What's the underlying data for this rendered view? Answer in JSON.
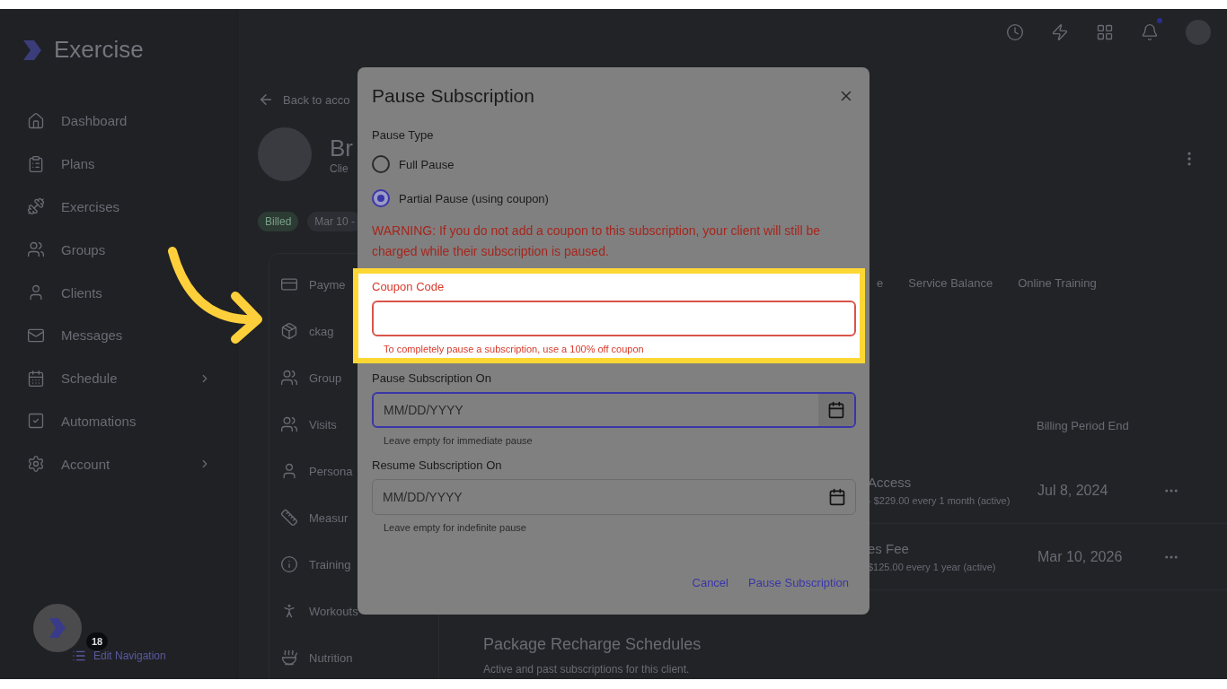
{
  "sidebar": {
    "brand": "Exercise",
    "items": [
      {
        "label": "Dashboard",
        "expandable": false
      },
      {
        "label": "Plans",
        "expandable": false
      },
      {
        "label": "Exercises",
        "expandable": false
      },
      {
        "label": "Groups",
        "expandable": false
      },
      {
        "label": "Clients",
        "expandable": false
      },
      {
        "label": "Messages",
        "expandable": false
      },
      {
        "label": "Schedule",
        "expandable": true
      },
      {
        "label": "Automations",
        "expandable": false
      },
      {
        "label": "Account",
        "expandable": true
      }
    ],
    "badge": "18",
    "edit_navigation": "Edit Navigation"
  },
  "topbar": {
    "notification_dot": true
  },
  "client": {
    "back_link": "Back to acco",
    "name": "Br",
    "subtitle": "Clie",
    "chips": [
      "Billed",
      "Mar 10 -"
    ],
    "menu": [
      "Payme",
      "ckag",
      "Group",
      "Visits",
      "Persona",
      "Measur",
      "Training",
      "Workouts",
      "Nutrition"
    ]
  },
  "tabs": [
    {
      "label": "e",
      "selected": false
    },
    {
      "label": "Service Balance",
      "selected": false
    },
    {
      "label": "Online Training",
      "selected": false
    }
  ],
  "table": {
    "columns": [
      "Billing Period End"
    ],
    "rows": [
      {
        "name": "Access",
        "detail": "- $229.00 every 1 month (active)",
        "end": "Jul 8, 2024"
      },
      {
        "name": "es Fee",
        "detail": "$125.00 every 1 year (active)",
        "end": "Mar 10, 2026"
      }
    ]
  },
  "recharge": {
    "title": "Package Recharge Schedules",
    "subtitle": "Active and past subscriptions for this client."
  },
  "dialog": {
    "title": "Pause Subscription",
    "pause_type_label": "Pause Type",
    "options": [
      {
        "label": "Full Pause",
        "selected": false
      },
      {
        "label": "Partial Pause (using coupon)",
        "selected": true
      }
    ],
    "warning": "WARNING: If you do not add a coupon to this subscription, your client will still be charged while their subscription is paused.",
    "fields": [
      {
        "kind": "text",
        "label": "Coupon Code",
        "error": true,
        "focused": false,
        "highlighted": true,
        "helper": "To completely pause a subscription, use a 100% off coupon"
      },
      {
        "kind": "date",
        "label": "Pause Subscription On",
        "error": false,
        "focused": true,
        "highlighted": false,
        "placeholder": "MM/DD/YYYY",
        "helper": "Leave empty for immediate pause"
      },
      {
        "kind": "date",
        "label": "Resume Subscription On",
        "error": false,
        "focused": false,
        "highlighted": false,
        "placeholder": "MM/DD/YYYY",
        "helper": "Leave empty for indefinite pause"
      }
    ],
    "buttons": [
      "Cancel",
      "Pause Subscription"
    ]
  }
}
